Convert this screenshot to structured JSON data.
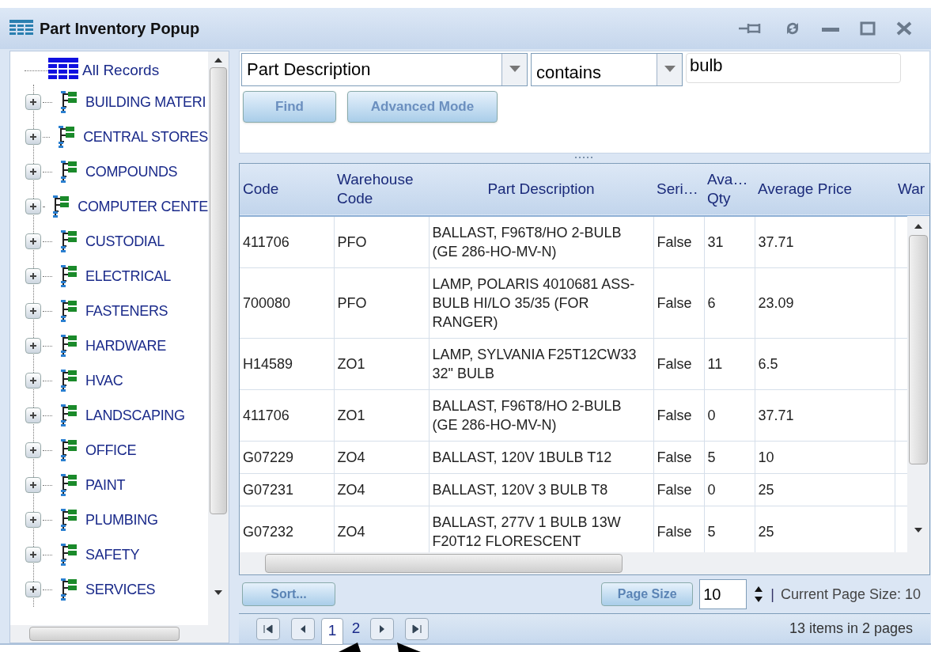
{
  "window": {
    "title": "Part Inventory Popup"
  },
  "tree": {
    "root": {
      "label": "All Records",
      "children": [
        {
          "label": "BUILDING MATERI",
          "expanded": false
        },
        {
          "label": "CENTRAL STORES",
          "expanded": false
        },
        {
          "label": "COMPOUNDS",
          "expanded": false
        },
        {
          "label": "COMPUTER CENTE",
          "expanded": false
        },
        {
          "label": "CUSTODIAL",
          "expanded": false
        },
        {
          "label": "ELECTRICAL",
          "expanded": false
        },
        {
          "label": "FASTENERS",
          "expanded": false
        },
        {
          "label": "HARDWARE",
          "expanded": false
        },
        {
          "label": "HVAC",
          "expanded": false
        },
        {
          "label": "LANDSCAPING",
          "expanded": false
        },
        {
          "label": "OFFICE",
          "expanded": false
        },
        {
          "label": "PAINT",
          "expanded": false
        },
        {
          "label": "PLUMBING",
          "expanded": false
        },
        {
          "label": "SAFETY",
          "expanded": false
        },
        {
          "label": "SERVICES",
          "expanded": false
        }
      ]
    }
  },
  "filter": {
    "field": "Part Description",
    "operator": "contains",
    "value": "bulb",
    "buttons": [
      "Find",
      "Advanced Mode"
    ]
  },
  "table": {
    "columns": [
      "Code",
      "Warehouse Code",
      "Part Description",
      "Seri…",
      "Ava… Qty",
      "Average Price",
      "War"
    ],
    "rows": [
      [
        "411706",
        "PFO",
        "BALLAST, F96T8/HO 2-BULB (GE 286-HO-MV-N)",
        "False",
        "31",
        "37.71"
      ],
      [
        "700080",
        "PFO",
        "LAMP, POLARIS 4010681 ASS-BULB HI/LO 35/35 (FOR RANGER)",
        "False",
        "6",
        "23.09"
      ],
      [
        "H14589",
        "ZO1",
        "LAMP, SYLVANIA F25T12CW33 32\" BULB",
        "False",
        "11",
        "6.5"
      ],
      [
        "411706",
        "ZO1",
        "BALLAST, F96T8/HO 2-BULB (GE 286-HO-MV-N)",
        "False",
        "0",
        "37.71"
      ],
      [
        "G07229",
        "ZO4",
        "BALLAST, 120V 1BULB T12",
        "False",
        "5",
        "10"
      ],
      [
        "G07231",
        "ZO4",
        "BALLAST, 120V 3 BULB T8",
        "False",
        "0",
        "25"
      ],
      [
        "G07232",
        "ZO4",
        "BALLAST, 277V 1 BULB 13W F20T12 FLORESCENT",
        "False",
        "5",
        "25"
      ]
    ]
  },
  "footer": {
    "sort_button": "Sort...",
    "page_size_button": "Page Size",
    "page_size_value": "10",
    "separator": "|",
    "current_page_size": "Current Page Size: 10"
  },
  "pager": {
    "pages": [
      {
        "label": "1",
        "selected": true
      },
      {
        "label": "2",
        "selected": false
      }
    ],
    "summary": "13 items in 2 pages"
  }
}
